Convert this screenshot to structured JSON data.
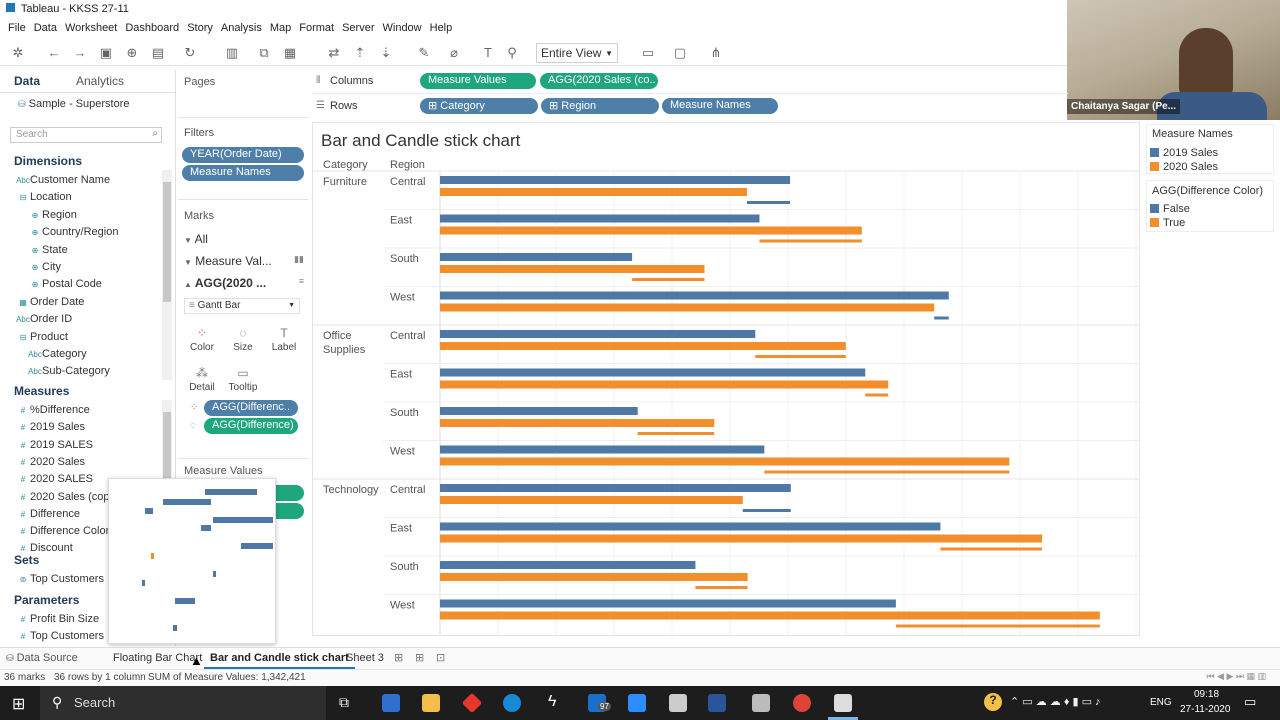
{
  "window": {
    "title": "Tableau - KKSS 27-11"
  },
  "menu": [
    "File",
    "Data",
    "Worksheet",
    "Dashboard",
    "Story",
    "Analysis",
    "Map",
    "Format",
    "Server",
    "Window",
    "Help"
  ],
  "toolbar": {
    "view_select": "Entire View"
  },
  "data_pane": {
    "tabs": [
      "Data",
      "Analytics"
    ],
    "source": "Sample - Superstore",
    "search_placeholder": "Search",
    "dimensions_label": "Dimensions",
    "dimensions": [
      "Customer Name",
      "Location",
      "Region",
      "Country/Region",
      "State",
      "City",
      "Postal Code",
      "Order Date",
      "Order ID",
      "Product",
      "Category",
      "Sub-Category"
    ],
    "measures_label": "Measures",
    "measures": [
      "%Difference",
      "2019 Sales",
      "2019 SALES",
      "2020 Sales",
      "2020 SALES",
      "2020 Sales (cop",
      "Difference",
      "Difference Color",
      "Discount"
    ],
    "sets_label": "Sets",
    "sets": [
      "Top Customers I"
    ],
    "parameters_label": "Parameters",
    "parameters": [
      "Profit Bin Size",
      "Top Customers"
    ]
  },
  "cards": {
    "pages_label": "Pages",
    "filters_label": "Filters",
    "filters": [
      "YEAR(Order Date)",
      "Measure Names"
    ],
    "marks_label": "Marks",
    "marks_all": "All",
    "marks_measure": "Measure Val...",
    "marks_agg": "AGG(2020 ...",
    "mark_type": "Gantt Bar",
    "mark_buttons": [
      "Color",
      "Size",
      "Label",
      "Detail",
      "Tooltip"
    ],
    "mark_pills": [
      "AGG(Differenc..",
      "AGG(Difference)"
    ],
    "measure_values_label": "Measure Values"
  },
  "shelves": {
    "columns_label": "Columns",
    "columns": [
      "Measure Values",
      "AGG(2020 Sales (co.."
    ],
    "rows_label": "Rows",
    "rows": [
      "Category",
      "Region",
      "Measure Names"
    ]
  },
  "sheet_title": "Bar and Candle stick chart",
  "col_headers": [
    "Category",
    "Region"
  ],
  "colors": {
    "s2019": "#4e79a7",
    "s2020": "#f28e2b",
    "green": "#1ea67c",
    "blue_pill": "#4e7fa8"
  },
  "legend": {
    "title1": "Measure Names",
    "items1": [
      "2019 Sales",
      "2020 Sales"
    ],
    "title2": "AGG(Difference Color)",
    "items2": [
      "False",
      "True"
    ]
  },
  "chart_data": {
    "type": "bar",
    "title": "Bar and Candle stick chart",
    "categories": [
      "Furniture",
      "Office Supplies",
      "Technology"
    ],
    "regions": [
      "Central",
      "East",
      "South",
      "West"
    ],
    "series": [
      {
        "name": "2019 Sales",
        "values": [
          [
            0.503,
            0.459,
            0.276,
            0.731
          ],
          [
            0.453,
            0.611,
            0.284,
            0.466
          ],
          [
            0.504,
            0.719,
            0.367,
            0.655
          ]
        ]
      },
      {
        "name": "2020 Sales",
        "values": [
          [
            0.441,
            0.606,
            0.38,
            0.71
          ],
          [
            0.583,
            0.644,
            0.394,
            0.818
          ],
          [
            0.435,
            0.865,
            0.442,
            0.948
          ]
        ]
      }
    ],
    "value_scale_note": "fraction of the longest visible axis extent",
    "candles": [
      [
        {
          "true": false
        },
        {
          "true": true
        },
        {
          "true": true
        },
        {
          "true": false
        }
      ],
      [
        {
          "true": true
        },
        {
          "true": true
        },
        {
          "true": true
        },
        {
          "true": true
        }
      ],
      [
        {
          "true": false
        },
        {
          "true": true
        },
        {
          "true": true
        },
        {
          "true": true
        }
      ]
    ]
  },
  "sheet_tabs": {
    "data_source": "Data Source",
    "tabs": [
      "Floating Bar Chart",
      "Bar and Candle stick chart",
      "Sheet 3"
    ],
    "active": 1
  },
  "status": {
    "marks": "36 marks",
    "rows": "36 rows by 1 column",
    "sum": "SUM of Measure Values: 1,342,421"
  },
  "webcam": {
    "name": "Chaitanya Sagar (Pe..."
  },
  "taskbar": {
    "search": "Search",
    "time": "09:18",
    "date": "27-11-2020",
    "lang": "ENG",
    "mail_badge": "97"
  }
}
